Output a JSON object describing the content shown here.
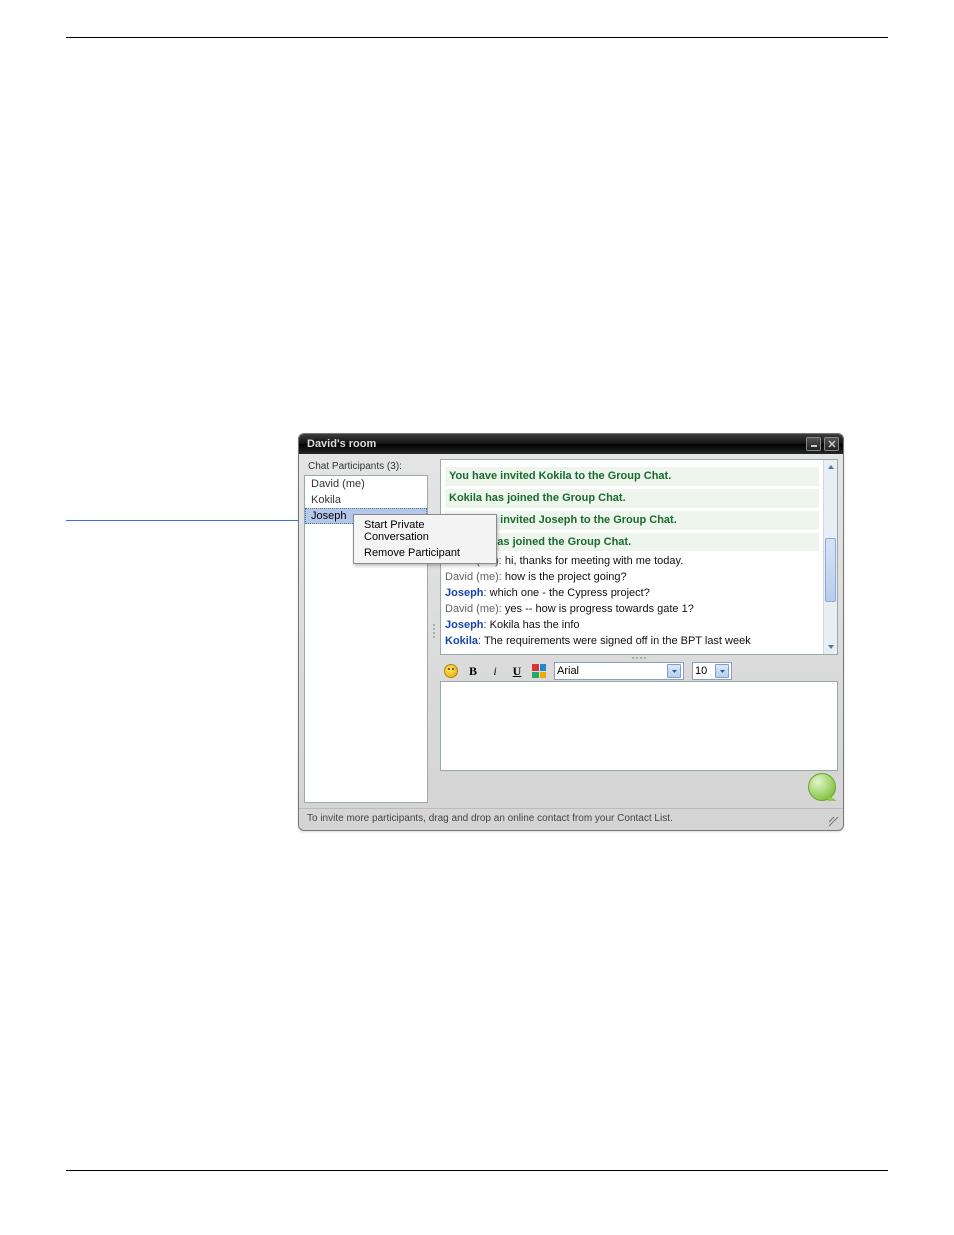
{
  "window": {
    "title": "David's room"
  },
  "sidebar": {
    "participants_label": "Chat Participants (3):",
    "participants": [
      "David (me)",
      "Kokila",
      "Joseph"
    ],
    "selected_index": 2
  },
  "context_menu": {
    "items": [
      "Start Private Conversation",
      "Remove Participant"
    ]
  },
  "conversation": {
    "system": [
      "You have invited Kokila to the Group Chat.",
      "Kokila has joined the Group Chat.",
      "You have invited Joseph to the Group Chat.",
      "Joseph has joined the Group Chat."
    ],
    "messages": [
      {
        "who": "David (me)",
        "me": true,
        "text": "hi, thanks for meeting with me today."
      },
      {
        "who": "David (me)",
        "me": true,
        "text": "how is the project going?"
      },
      {
        "who": "Joseph",
        "me": false,
        "text": "which one - the Cypress project?"
      },
      {
        "who": "David (me)",
        "me": true,
        "text": "yes -- how is progress towards gate 1?"
      },
      {
        "who": "Joseph",
        "me": false,
        "text": "Kokila has the info"
      },
      {
        "who": "Kokila",
        "me": false,
        "text": "The requirements were signed off in the BPT last week"
      }
    ]
  },
  "toolbar": {
    "bold_label": "B",
    "italic_label": "i",
    "underline_label": "U",
    "font_value": "Arial",
    "size_value": "10"
  },
  "footer": {
    "tip": "To invite more participants, drag and drop an online contact from your Contact List."
  }
}
